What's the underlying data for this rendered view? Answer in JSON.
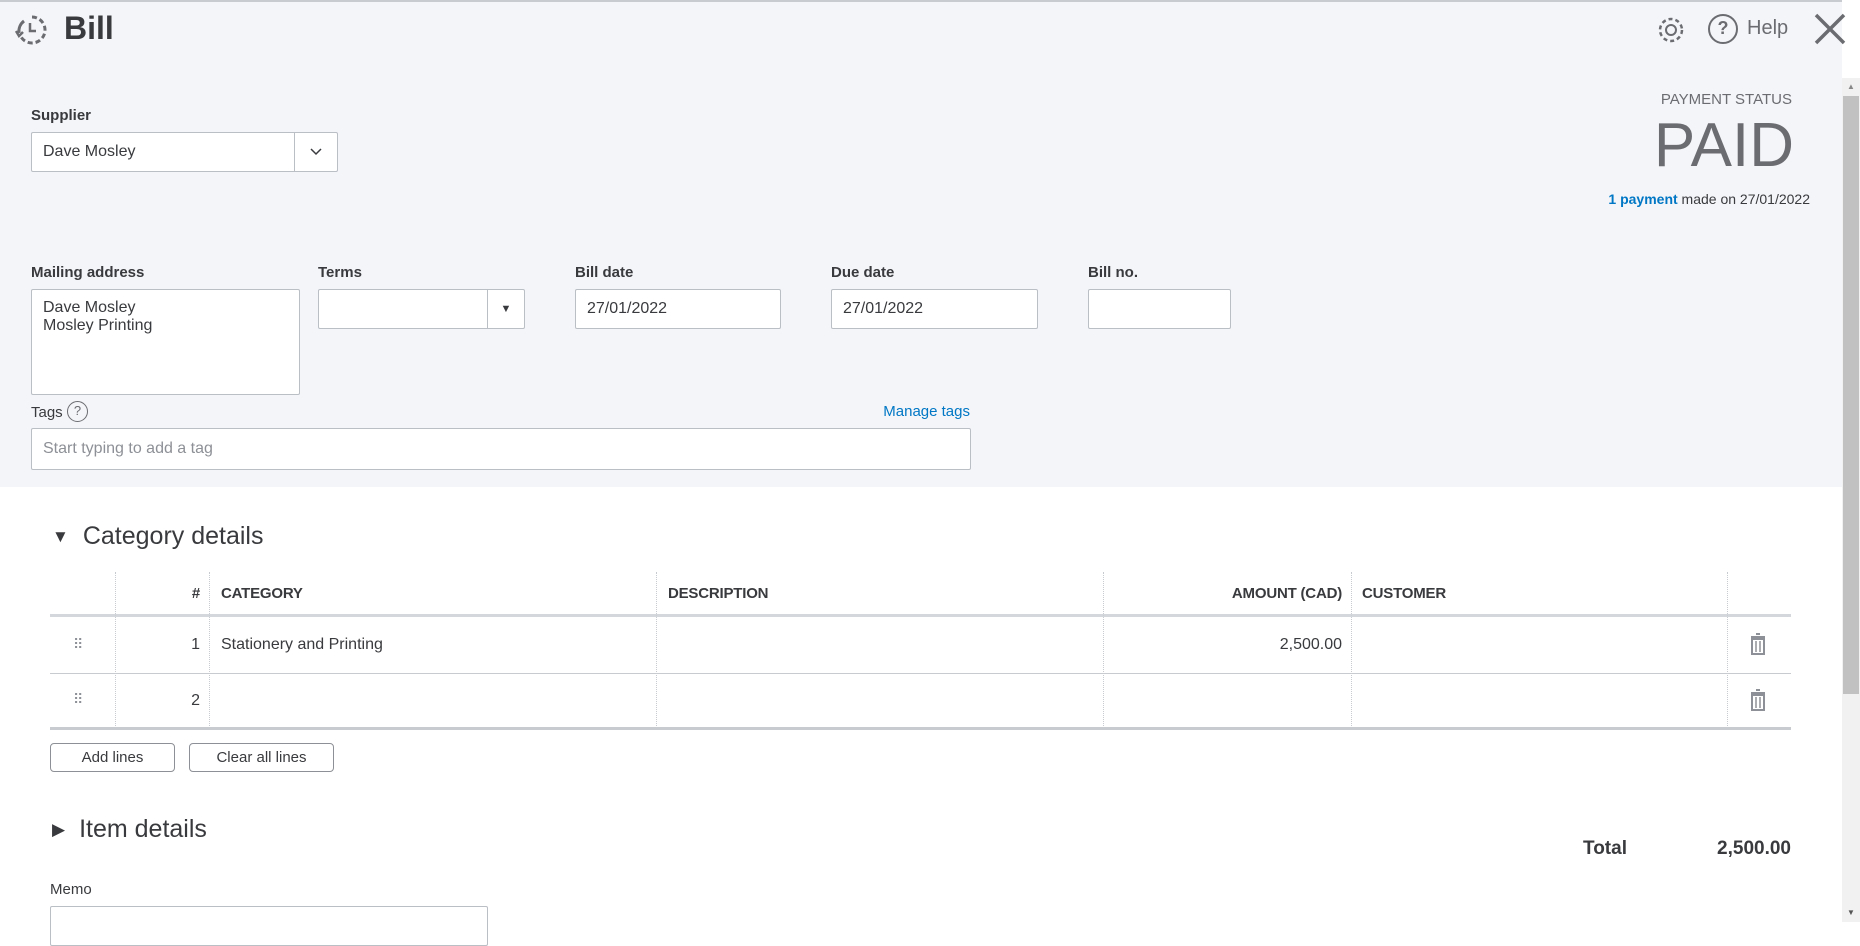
{
  "header": {
    "title": "Bill",
    "help_label": "Help"
  },
  "supplier": {
    "label": "Supplier",
    "value": "Dave Mosley"
  },
  "payment_status": {
    "label": "PAYMENT STATUS",
    "status": "PAID",
    "payment_link": "1 payment",
    "payment_text": "made on 27/01/2022"
  },
  "form": {
    "mailing_address": {
      "label": "Mailing address",
      "line1": "Dave Mosley",
      "line2": "Mosley Printing"
    },
    "terms": {
      "label": "Terms",
      "value": ""
    },
    "bill_date": {
      "label": "Bill date",
      "value": "27/01/2022"
    },
    "due_date": {
      "label": "Due date",
      "value": "27/01/2022"
    },
    "bill_no": {
      "label": "Bill no.",
      "value": ""
    },
    "tags": {
      "label": "Tags",
      "manage": "Manage tags",
      "placeholder": "Start typing to add a tag"
    }
  },
  "category_details": {
    "title": "Category details",
    "columns": {
      "num": "#",
      "category": "CATEGORY",
      "description": "DESCRIPTION",
      "amount": "AMOUNT (CAD)",
      "customer": "CUSTOMER"
    },
    "rows": [
      {
        "num": "1",
        "category": "Stationery and Printing",
        "description": "",
        "amount": "2,500.00",
        "customer": ""
      },
      {
        "num": "2",
        "category": "",
        "description": "",
        "amount": "",
        "customer": ""
      }
    ],
    "add_lines": "Add lines",
    "clear_lines": "Clear all lines"
  },
  "item_details": {
    "title": "Item details"
  },
  "total": {
    "label": "Total",
    "value": "2,500.00"
  },
  "memo": {
    "label": "Memo",
    "value": ""
  }
}
